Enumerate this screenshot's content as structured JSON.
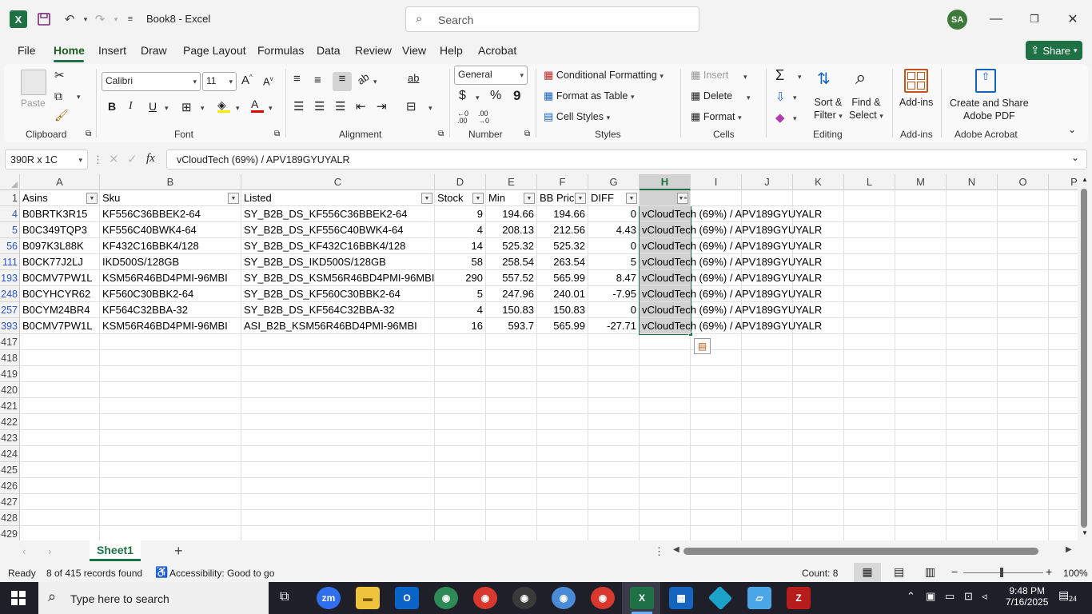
{
  "window": {
    "title": "Book8  -  Excel",
    "user_initials": "SA"
  },
  "search": {
    "placeholder": "Search"
  },
  "menu": {
    "tabs": [
      "File",
      "Home",
      "Insert",
      "Draw",
      "Page Layout",
      "Formulas",
      "Data",
      "Review",
      "View",
      "Help",
      "Acrobat"
    ],
    "active": "Home",
    "share_label": "Share"
  },
  "ribbon": {
    "clipboard": {
      "paste": "Paste",
      "label": "Clipboard"
    },
    "font": {
      "name": "Calibri",
      "size": "11",
      "label": "Font",
      "bold": "B",
      "italic": "I",
      "underline": "U"
    },
    "alignment": {
      "label": "Alignment"
    },
    "number": {
      "format": "General",
      "label": "Number",
      "currency": "$",
      "percent": "%",
      "comma": "9"
    },
    "styles": {
      "conditional": "Conditional Formatting",
      "format_table": "Format as Table",
      "cell_styles": "Cell Styles",
      "label": "Styles"
    },
    "cells": {
      "insert": "Insert",
      "delete": "Delete",
      "format": "Format",
      "label": "Cells"
    },
    "editing": {
      "sort": "Sort &",
      "filter": "Filter",
      "find": "Find &",
      "select": "Select",
      "label": "Editing"
    },
    "addins": {
      "button": "Add-ins",
      "label": "Add-ins"
    },
    "acrobat": {
      "line1": "Create and Share",
      "line2": "Adobe PDF",
      "label": "Adobe Acrobat"
    }
  },
  "formula_bar": {
    "name_box": "390R x 1C",
    "fx": "fx",
    "content": "vCloudTech (69%) / APV189GYUYALR"
  },
  "columns": [
    "A",
    "B",
    "C",
    "D",
    "E",
    "F",
    "G",
    "H",
    "I",
    "J",
    "K",
    "L",
    "M",
    "N",
    "O",
    "P"
  ],
  "headers": [
    "Asins",
    "Sku",
    "Listed",
    "Stock",
    "Min",
    "BB Price",
    "DIFF",
    ""
  ],
  "rows": [
    {
      "row": "4",
      "asin": "B0BRTK3R15",
      "sku": "KF556C36BBEK2-64",
      "listed": "SY_B2B_DS_KF556C36BBEK2-64",
      "stock": "9",
      "min": "194.66",
      "bb": "194.66",
      "diff": "0",
      "h": "vCloudTech (69%) / APV189GYUYALR"
    },
    {
      "row": "5",
      "asin": "B0C349TQP3",
      "sku": "KF556C40BWK4-64",
      "listed": "SY_B2B_DS_KF556C40BWK4-64",
      "stock": "4",
      "min": "208.13",
      "bb": "212.56",
      "diff": "4.43",
      "h": "vCloudTech (69%) / APV189GYUYALR"
    },
    {
      "row": "56",
      "asin": "B097K3L88K",
      "sku": "KF432C16BBK4/128",
      "listed": "SY_B2B_DS_KF432C16BBK4/128",
      "stock": "14",
      "min": "525.32",
      "bb": "525.32",
      "diff": "0",
      "h": "vCloudTech (69%) / APV189GYUYALR"
    },
    {
      "row": "111",
      "asin": "B0CK77J2LJ",
      "sku": "IKD500S/128GB",
      "listed": "SY_B2B_DS_IKD500S/128GB",
      "stock": "58",
      "min": "258.54",
      "bb": "263.54",
      "diff": "5",
      "h": "vCloudTech (69%) / APV189GYUYALR"
    },
    {
      "row": "193",
      "asin": "B0CMV7PW1L",
      "sku": "KSM56R46BD4PMI-96MBI",
      "listed": "SY_B2B_DS_KSM56R46BD4PMI-96MBI",
      "stock": "290",
      "min": "557.52",
      "bb": "565.99",
      "diff": "8.47",
      "h": "vCloudTech (69%) / APV189GYUYALR"
    },
    {
      "row": "248",
      "asin": "B0CYHCYR62",
      "sku": "KF560C30BBK2-64",
      "listed": "SY_B2B_DS_KF560C30BBK2-64",
      "stock": "5",
      "min": "247.96",
      "bb": "240.01",
      "diff": "-7.95",
      "h": "vCloudTech (69%) / APV189GYUYALR"
    },
    {
      "row": "257",
      "asin": "B0CYM24BR4",
      "sku": "KF564C32BBA-32",
      "listed": "SY_B2B_DS_KF564C32BBA-32",
      "stock": "4",
      "min": "150.83",
      "bb": "150.83",
      "diff": "0",
      "h": "vCloudTech (69%) / APV189GYUYALR"
    },
    {
      "row": "393",
      "asin": "B0CMV7PW1L",
      "sku": "KSM56R46BD4PMI-96MBI",
      "listed": "ASI_B2B_KSM56R46BD4PMI-96MBI",
      "stock": "16",
      "min": "593.7",
      "bb": "565.99",
      "diff": "-27.71",
      "h": "vCloudTech (69%) / APV189GYUYALR"
    }
  ],
  "empty_rows": [
    "417",
    "418",
    "419",
    "420",
    "421",
    "422",
    "423",
    "424",
    "425",
    "426",
    "427",
    "428",
    "429"
  ],
  "header_row": "1",
  "sheet": {
    "name": "Sheet1",
    "add": "+"
  },
  "status": {
    "ready": "Ready",
    "records": "8 of 415 records found",
    "accessibility": "Accessibility: Good to go",
    "count": "Count: 8",
    "zoom": "100%"
  },
  "taskbar": {
    "search_placeholder": "Type here to search",
    "time": "9:48 PM",
    "date": "7/16/2025",
    "notif_count": "24"
  },
  "colors": {
    "excel_green": "#1e7145",
    "selection": "#d2d2d2",
    "filter_row_header": "#2b55c5"
  }
}
